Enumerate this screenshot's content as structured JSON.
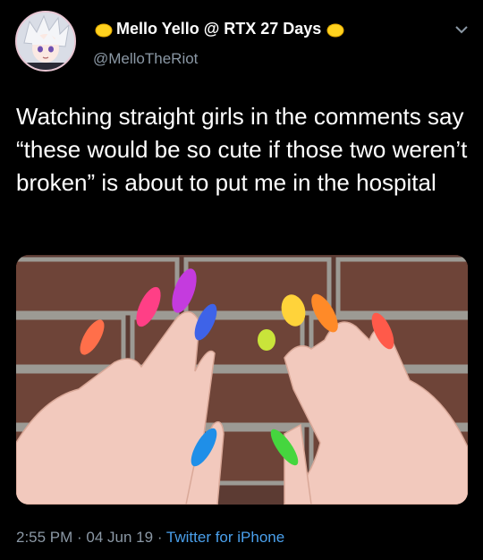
{
  "user": {
    "display_name": "Mello Yello @ RTX 27 Days",
    "handle": "@MelloTheRiot",
    "avatar_icon": "anime-character-avatar",
    "name_emoji_icon": "lemon-icon"
  },
  "tweet": {
    "text": "Watching straight girls in the comments say “these would be so cute if those two weren’t broken” is about to put me in the hospital"
  },
  "media": {
    "nail_colors": [
      "#ff6f4a",
      "#ff3f86",
      "#c43bde",
      "#3e63e8",
      "#1f8fe8",
      "#c9e43a",
      "#ffd33a",
      "#ff8a28",
      "#ff5a4a",
      "#45d63e"
    ]
  },
  "meta": {
    "time": "2:55 PM",
    "sep1": " · ",
    "date": "04 Jun 19",
    "sep2": " · ",
    "source": "Twitter for iPhone"
  }
}
